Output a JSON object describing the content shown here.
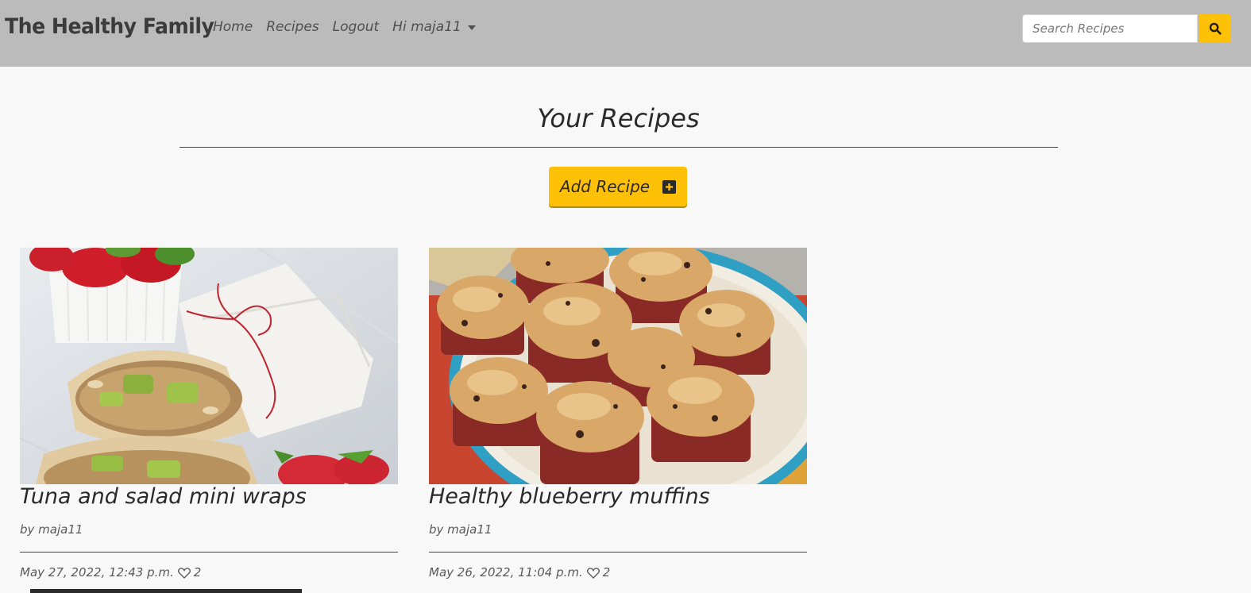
{
  "navbar": {
    "brand": "The Healthy Family",
    "links": [
      {
        "label": "Home"
      },
      {
        "label": "Recipes"
      },
      {
        "label": "Logout"
      }
    ],
    "user_menu": "Hi maja11",
    "search_placeholder": "Search Recipes",
    "accent": "#ffc107",
    "background": "#bbbbbb"
  },
  "main": {
    "title": "Your Recipes",
    "add_button_label": "Add Recipe",
    "recipes": [
      {
        "title": "Tuna and salad mini wraps",
        "author": "by maja11",
        "date": "May 27, 2022, 12:43 p.m.",
        "likes": "2",
        "image": "tuna-wrap-photo"
      },
      {
        "title": "Healthy blueberry muffins",
        "author": "by maja11",
        "date": "May 26, 2022, 11:04 p.m.",
        "likes": "2",
        "image": "muffins-photo"
      }
    ]
  }
}
